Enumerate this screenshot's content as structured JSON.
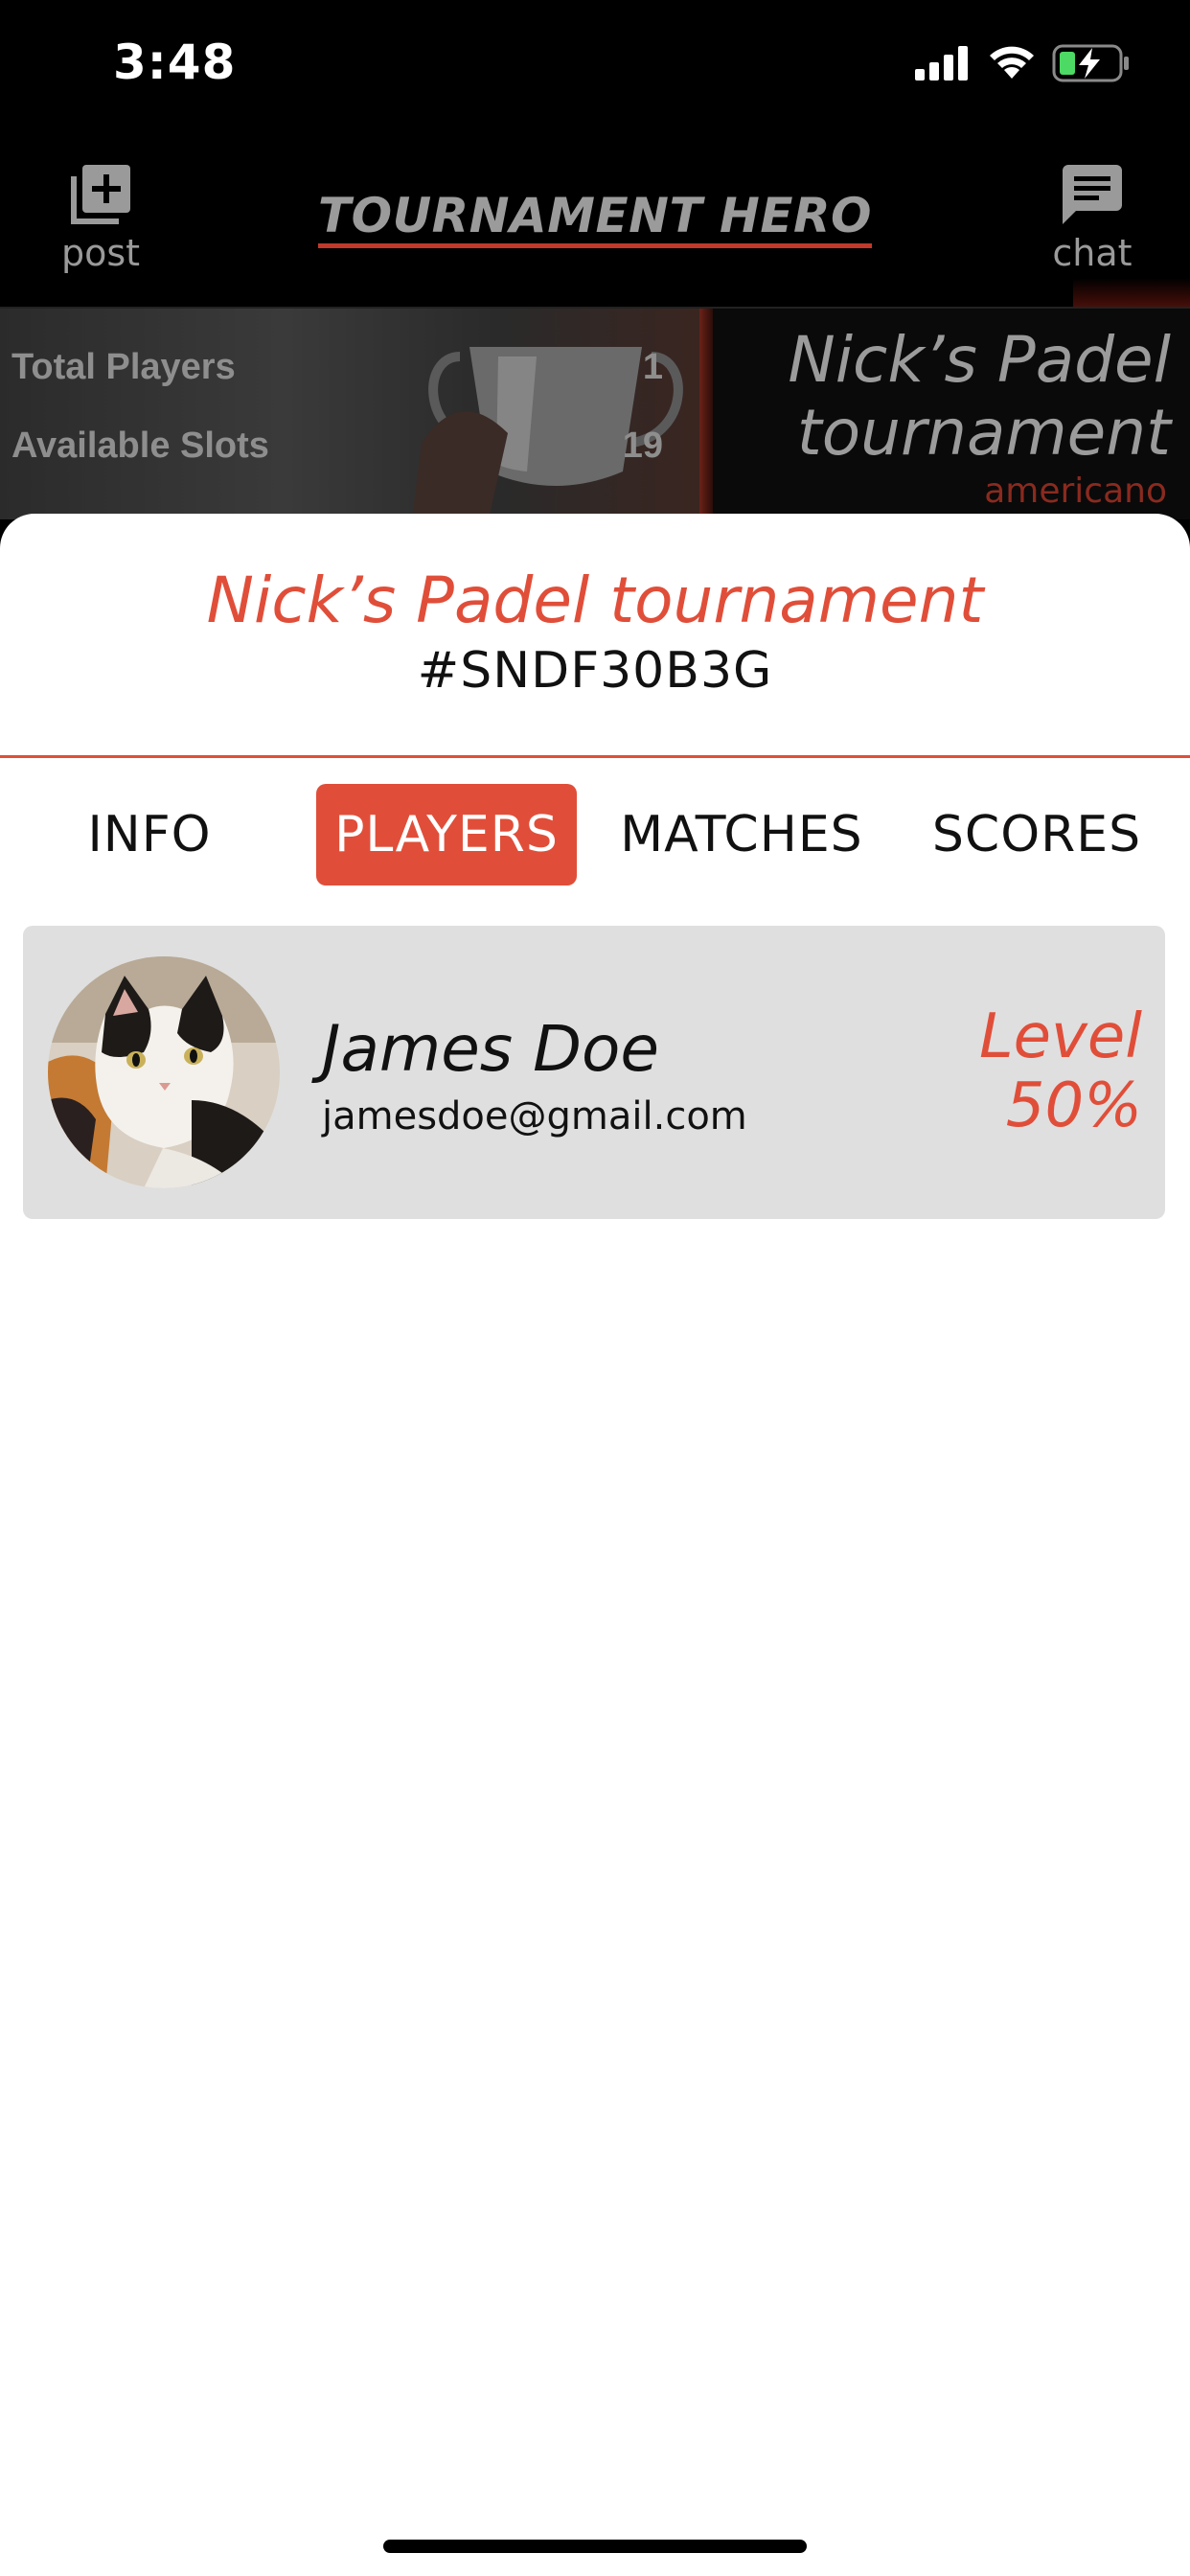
{
  "status_bar": {
    "time": "3:48"
  },
  "header": {
    "post_label": "post",
    "title": "TOURNAMENT HERO",
    "chat_label": "chat"
  },
  "banner": {
    "stats": [
      {
        "label": "Total Players",
        "value": "1"
      },
      {
        "label": "Available Slots",
        "value": "19"
      }
    ],
    "name_line1": "Nick’s Padel",
    "name_line2": "tournament",
    "type": "americano"
  },
  "sheet": {
    "tournament_name": "Nick’s Padel tournament",
    "tournament_code": "#SNDF30B3G",
    "tabs": [
      {
        "label": "INFO",
        "active": false
      },
      {
        "label": "PLAYERS",
        "active": true
      },
      {
        "label": "MATCHES",
        "active": false
      },
      {
        "label": "SCORES",
        "active": false
      }
    ]
  },
  "players": [
    {
      "name": "James Doe",
      "email": "jamesdoe@gmail.com",
      "level_label": "Level",
      "level_value": "50%"
    }
  ],
  "colors": {
    "accent": "#e04e39",
    "card_bg": "#dfdfdf"
  }
}
